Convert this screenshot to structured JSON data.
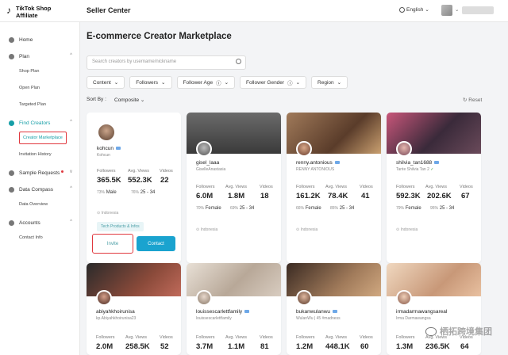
{
  "header": {
    "logo_main": "TikTok Shop",
    "logo_sub": "Affiliate",
    "seller_center": "Seller Center",
    "language": "English"
  },
  "sidebar": {
    "items": [
      {
        "label": "Home",
        "type": "group"
      },
      {
        "label": "Plan",
        "type": "group",
        "chevron": "^"
      },
      {
        "label": "Shop Plan",
        "type": "sub"
      },
      {
        "label": "Open Plan",
        "type": "sub"
      },
      {
        "label": "Targeted Plan",
        "type": "sub"
      },
      {
        "label": "Find Creators",
        "type": "group",
        "chevron": "^",
        "active": true
      },
      {
        "label": "Creator Marketplace",
        "type": "sub",
        "active": true
      },
      {
        "label": "Invitation History",
        "type": "sub"
      },
      {
        "label": "Sample Requests",
        "type": "group",
        "chevron": "v",
        "dot": true
      },
      {
        "label": "Data Compass",
        "type": "group",
        "chevron": "^"
      },
      {
        "label": "Data Overview",
        "type": "sub"
      },
      {
        "label": "Accounts",
        "type": "group",
        "chevron": "^"
      },
      {
        "label": "Contact Info",
        "type": "sub"
      }
    ]
  },
  "main": {
    "title": "E-commerce Creator Marketplace",
    "search_placeholder": "Search creators by username/nickname",
    "filters": [
      "Content",
      "Followers",
      "Follower Age",
      "Follower Gender",
      "Region"
    ],
    "sort_label": "Sort By :",
    "sort_value": "Composite",
    "reset_label": "Reset",
    "stat_labels": {
      "followers": "Followers",
      "views": "Avg. Views",
      "videos": "Videos"
    }
  },
  "creators": [
    {
      "username": "kohcun",
      "handle": "Kohcun",
      "followers": "365.5K",
      "views": "552.3K",
      "videos": "22",
      "gender_pct": "73%",
      "gender": "Male",
      "age_pct": "76%",
      "age": "25 - 34",
      "location": "Indonesia",
      "tag": "Tech Products & Infos",
      "invite_label": "Invite",
      "contact_label": "Contact"
    },
    {
      "username": "gisel_laaa",
      "handle": "GiselleAnastasia",
      "followers": "6.0M",
      "views": "1.8M",
      "videos": "18",
      "gender_pct": "70%",
      "gender": "Female",
      "age_pct": "69%",
      "age": "25 - 34",
      "location": "Indonesia"
    },
    {
      "username": "renny.antonious",
      "handle": "RENNY ANTONIOUS",
      "followers": "161.2K",
      "views": "78.4K",
      "videos": "41",
      "gender_pct": "66%",
      "gender": "Female",
      "age_pct": "85%",
      "age": "25 - 34",
      "location": "Indonesia"
    },
    {
      "username": "shilvia_tan1688",
      "handle": "Tante Shilvia Tan 2",
      "followers": "592.3K",
      "views": "202.6K",
      "videos": "67",
      "gender_pct": "79%",
      "gender": "Female",
      "age_pct": "95%",
      "age": "25 - 34",
      "location": "Indonesia"
    },
    {
      "username": "abiyahkhoirunisa",
      "handle": "kp.Abiyahkhoirunisa23",
      "followers": "2.0M",
      "views": "258.5K",
      "videos": "52"
    },
    {
      "username": "louissescarlettfamily",
      "handle": "louissescarlettfamily",
      "followers": "3.7M",
      "views": "1.1M",
      "videos": "81"
    },
    {
      "username": "bukanwulanwu",
      "handle": "WulanWu | 45 #madness",
      "followers": "1.2M",
      "views": "448.1K",
      "videos": "60"
    },
    {
      "username": "irmadarmawangsareal",
      "handle": "Irma Darmawangsa",
      "followers": "1.3M",
      "views": "236.5K",
      "videos": "64"
    }
  ],
  "watermark": "栖拓跨境集团",
  "colors": {
    "accent": "#159ea7",
    "highlight_box": "#e0383e",
    "contact_button": "#1aa3cf"
  }
}
